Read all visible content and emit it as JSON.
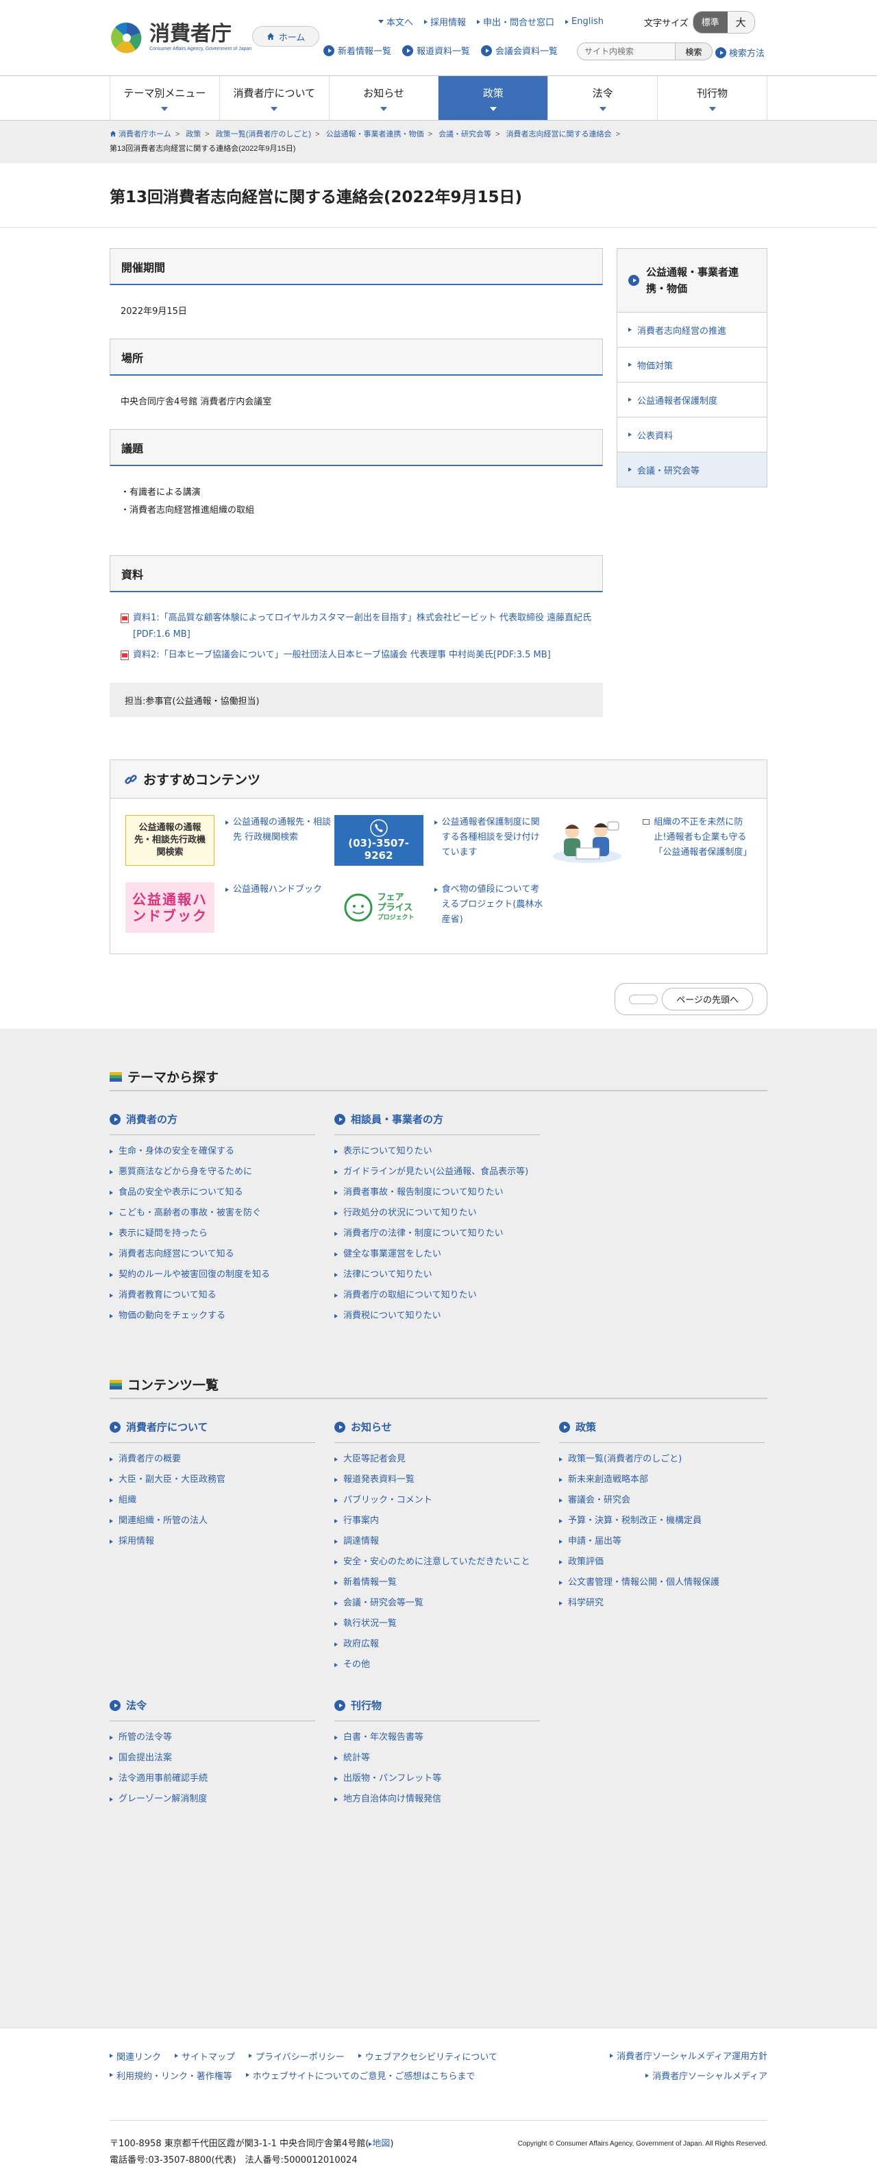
{
  "header": {
    "logo_title": "消費者庁",
    "logo_en": "Consumer Affairs Agency, Government of Japan",
    "home": "ホーム",
    "toplinks": [
      "本文へ",
      "採用情報",
      "申出・問合せ窓口",
      "English"
    ],
    "fontsize_label": "文字サイズ",
    "fontsize_std": "標準",
    "fontsize_big": "大",
    "sublinks": [
      "新着情報一覧",
      "報道資料一覧",
      "会議会資料一覧"
    ],
    "search_placeholder": "サイト内検索",
    "search_button": "検索",
    "howto": "検索方法"
  },
  "gnav": [
    "テーマ別メニュー",
    "消費者庁について",
    "お知らせ",
    "政策",
    "法令",
    "刊行物"
  ],
  "breadcrumb": [
    "消費者庁ホーム",
    "政策",
    "政策一覧(消費者庁のしごと)",
    "公益通報・事業者連携・物価",
    "会議・研究会等",
    "消費者志向経営に関する連絡会"
  ],
  "breadcrumb_current": "第13回消費者志向経営に関する連絡会(2022年9月15日)",
  "page_title": "第13回消費者志向経営に関する連絡会(2022年9月15日)",
  "content": {
    "period_h": "開催期間",
    "period": "2022年9月15日",
    "place_h": "場所",
    "place": "中央合同庁舎4号館 消費者庁内会議室",
    "agenda_h": "議題",
    "agenda": [
      "・有識者による講演",
      "・消費者志向経営推進組織の取組"
    ],
    "docs_h": "資料",
    "docs": [
      "資料1:「高品質な顧客体験によってロイヤルカスタマー創出を目指す」株式会社ビービット 代表取締役 遠藤直紀氏[PDF:1.6 MB]",
      "資料2:「日本ヒーブ協議会について」一般社団法人日本ヒーブ協議会 代表理事 中村尚美氏[PDF:3.5 MB]"
    ],
    "tanto": "担当:参事官(公益通報・協働担当)"
  },
  "side": {
    "heading": "公益通報・事業者連携・物価",
    "items": [
      "消費者志向経営の推進",
      "物価対策",
      "公益通報者保護制度",
      "公表資料",
      "会議・研究会等"
    ]
  },
  "reco": {
    "heading": "おすすめコンテンツ",
    "banner1": "公益通報の通報先・相談先行政機関検索",
    "banner2": "(03)-3507-9262",
    "banner4": "公益通報ハンドブック",
    "banner5_a": "フェア",
    "banner5_b": "プライス",
    "banner5_c": "プロジェクト",
    "items": [
      "公益通報の通報先・相談先 行政機関検索",
      "公益通報者保護制度に関する各種相談を受け付けています",
      "組織の不正を未然に防止!通報者も企業も守る「公益通報者保護制度」",
      "公益通報ハンドブック",
      "食べ物の値段について考えるプロジェクト(農林水産省)"
    ]
  },
  "totop": "ページの先頭へ",
  "theme": {
    "heading": "テーマから探す",
    "cols": [
      {
        "title": "消費者の方",
        "items": [
          "生命・身体の安全を確保する",
          "悪質商法などから身を守るために",
          "食品の安全や表示について知る",
          "こども・高齢者の事故・被害を防ぐ",
          "表示に疑問を持ったら",
          "消費者志向経営について知る",
          "契約のルールや被害回復の制度を知る",
          "消費者教育について知る",
          "物価の動向をチェックする"
        ]
      },
      {
        "title": "相談員・事業者の方",
        "items": [
          "表示について知りたい",
          "ガイドラインが見たい(公益通報、食品表示等)",
          "消費者事故・報告制度について知りたい",
          "行政処分の状況について知りたい",
          "消費者庁の法律・制度について知りたい",
          "健全な事業運営をしたい",
          "法律について知りたい",
          "消費者庁の取組について知りたい",
          "消費税について知りたい"
        ]
      }
    ]
  },
  "contents": {
    "heading": "コンテンツ一覧",
    "cols": [
      {
        "title": "消費者庁について",
        "items": [
          "消費者庁の概要",
          "大臣・副大臣・大臣政務官",
          "組織",
          "関連組織・所管の法人",
          "採用情報"
        ]
      },
      {
        "title": "お知らせ",
        "items": [
          "大臣等記者会見",
          "報道発表資料一覧",
          "パブリック・コメント",
          "行事案内",
          "調達情報",
          "安全・安心のために注意していただきたいこと",
          "新着情報一覧",
          "会議・研究会等一覧",
          "執行状況一覧",
          "政府広報",
          "その他"
        ]
      },
      {
        "title": "政策",
        "items": [
          "政策一覧(消費者庁のしごと)",
          "新未来創造戦略本部",
          "審議会・研究会",
          "予算・決算・税制改正・機構定員",
          "申請・届出等",
          "政策評価",
          "公文書管理・情報公開・個人情報保護",
          "科学研究"
        ]
      }
    ],
    "cols2": [
      {
        "title": "法令",
        "items": [
          "所管の法令等",
          "国会提出法案",
          "法令適用事前確認手続",
          "グレーゾーン解消制度"
        ]
      },
      {
        "title": "刊行物",
        "items": [
          "白書・年次報告書等",
          "統計等",
          "出版物・パンフレット等",
          "地方自治体向け情報発信"
        ]
      }
    ]
  },
  "footer": {
    "links": [
      "関連リンク",
      "サイトマップ",
      "プライバシーポリシー",
      "ウェブアクセシビリティについて",
      "利用規約・リンク・著作権等",
      "ホウェブサイトについてのご意見・ご感想はこちらまで"
    ],
    "links_right": [
      "消費者庁ソーシャルメディア運用方針",
      "消費者庁ソーシャルメディア"
    ],
    "address": "〒100-8958 東京都千代田区霞が関3-1-1 中央合同庁舎第4号館(",
    "map": "地図",
    "address_end": ")",
    "tel": "電話番号:03-3507-8800(代表)　法人番号:5000012010024",
    "copyright": "Copyright © Consumer Affairs Agency, Government of Japan. All Rights Reserved."
  },
  "colors": {
    "accent": "#3a6fb8",
    "link": "#2d5fa8",
    "gray": "#eeeeee"
  }
}
